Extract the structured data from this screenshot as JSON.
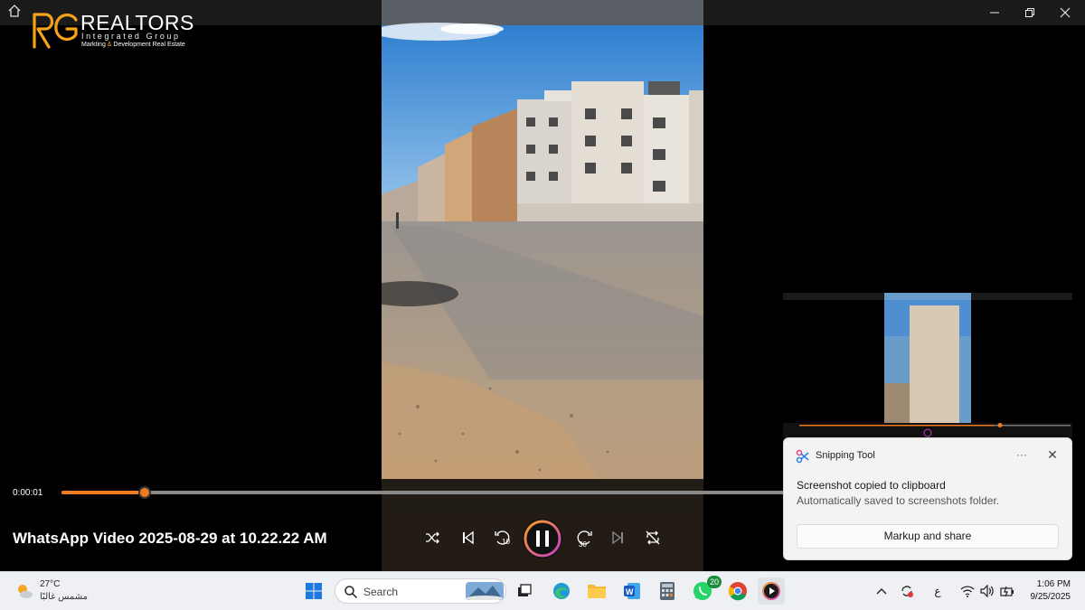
{
  "window": {
    "home_icon": "home-icon",
    "minimize_icon": "minimize-icon",
    "restore_icon": "restore-icon",
    "close_icon": "close-icon"
  },
  "logo": {
    "name": "REALTORS",
    "tagline": "Integrated Group",
    "subtitle_part1": "Markting ",
    "subtitle_amp": "&",
    "subtitle_part2": " Development Real Estate",
    "accent_color": "#f7a21b"
  },
  "player": {
    "current_time": "0:00:01",
    "progress_fraction": 0.114,
    "title": "WhatsApp Video 2025-08-29 at 10.22.22 AM",
    "accent_color": "#f07a1e",
    "rewind_label": "10",
    "forward_label": "30",
    "controls": [
      "shuffle-icon",
      "previous-icon",
      "rewind-10-icon",
      "pause-icon",
      "forward-30-icon",
      "next-icon",
      "repeat-off-icon"
    ]
  },
  "toast": {
    "app_name": "Snipping Tool",
    "more_label": "···",
    "close_label": "✕",
    "title": "Screenshot copied to clipboard",
    "message": "Automatically saved to screenshots folder.",
    "button_label": "Markup and share"
  },
  "taskbar": {
    "weather_temp": "27°C",
    "weather_desc": "مشمس غالبًا",
    "search_placeholder": "Search",
    "whatsapp_badge": "20",
    "tray_lang": "ع",
    "time": "1:06 PM",
    "date": "9/25/2025"
  }
}
